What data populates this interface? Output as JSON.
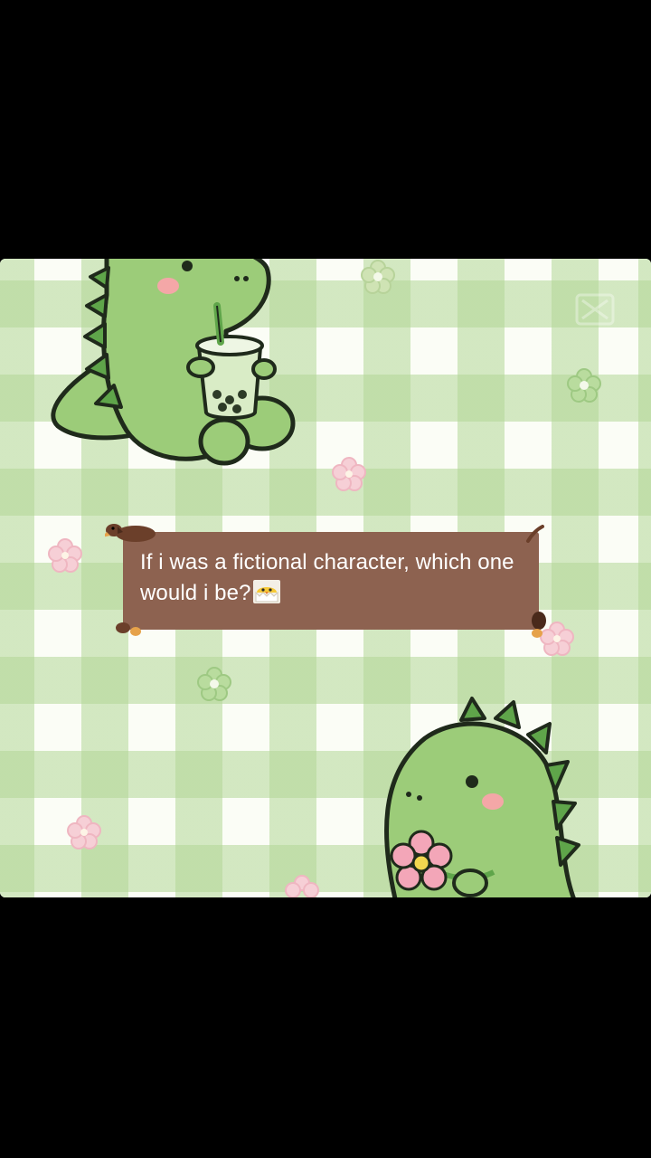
{
  "caption": {
    "text": "If i was a fictional character, which one would i be?",
    "emoji": "hatching-chick-icon"
  },
  "colors": {
    "background": "#000000",
    "gingham_light": "#fbfdf6",
    "gingham_green": "#b2d696",
    "dino_green": "#9ccc79",
    "dino_outline": "#1f2a1b",
    "caption_bg": "#8d6250",
    "caption_text": "#ffffff"
  },
  "icons": [
    "dino-boba-icon",
    "dino-flower-icon",
    "dachshund-icon",
    "flower-icon",
    "hatching-chick-icon"
  ]
}
